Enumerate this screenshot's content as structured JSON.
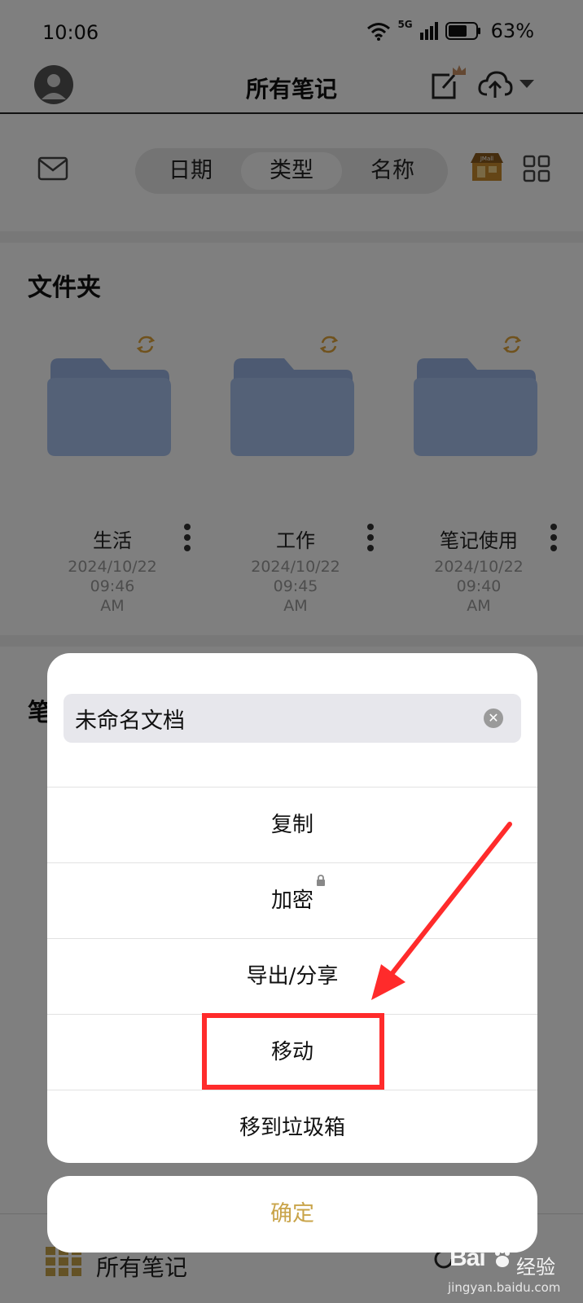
{
  "status_bar": {
    "time": "10:06",
    "network": "5G",
    "battery": "63%"
  },
  "header": {
    "title": "所有笔记",
    "icons": [
      "avatar",
      "edit-icon",
      "crown-icon",
      "cloud-upload-icon",
      "chevron-down-icon"
    ]
  },
  "sort_tabs": {
    "items": [
      {
        "label": "日期",
        "active": false
      },
      {
        "label": "类型",
        "active": true
      },
      {
        "label": "名称",
        "active": false
      }
    ],
    "store_badge": "JMall"
  },
  "folders": {
    "title": "文件夹",
    "items": [
      {
        "name": "生活",
        "date": "2024/10/22 09:46",
        "meridiem": "AM"
      },
      {
        "name": "工作",
        "date": "2024/10/22 09:45",
        "meridiem": "AM"
      },
      {
        "name": "笔记使用",
        "date": "2024/10/22 09:40",
        "meridiem": "AM"
      }
    ]
  },
  "notes": {
    "title_partial": "笔"
  },
  "bottom_bar": {
    "label": "所有笔记"
  },
  "sheet": {
    "name_value": "未命名文档",
    "menu": [
      {
        "label": "复制"
      },
      {
        "label": "加密",
        "locked": true
      },
      {
        "label": "导出/分享"
      },
      {
        "label": "移动",
        "highlighted": true
      },
      {
        "label": "移到垃圾箱"
      }
    ],
    "confirm_label": "确定"
  },
  "annotation": {
    "highlight_color": "#ff2b2b",
    "points_to": "移动"
  },
  "watermark": {
    "brand": "Bai",
    "brand_suffix": "经验",
    "url": "jingyan.baidu.com"
  },
  "colors": {
    "accent_gold": "#c9a44a",
    "folder_blue": "#9ab4e4",
    "dim_overlay": "rgba(0,0,0,0.5)"
  }
}
